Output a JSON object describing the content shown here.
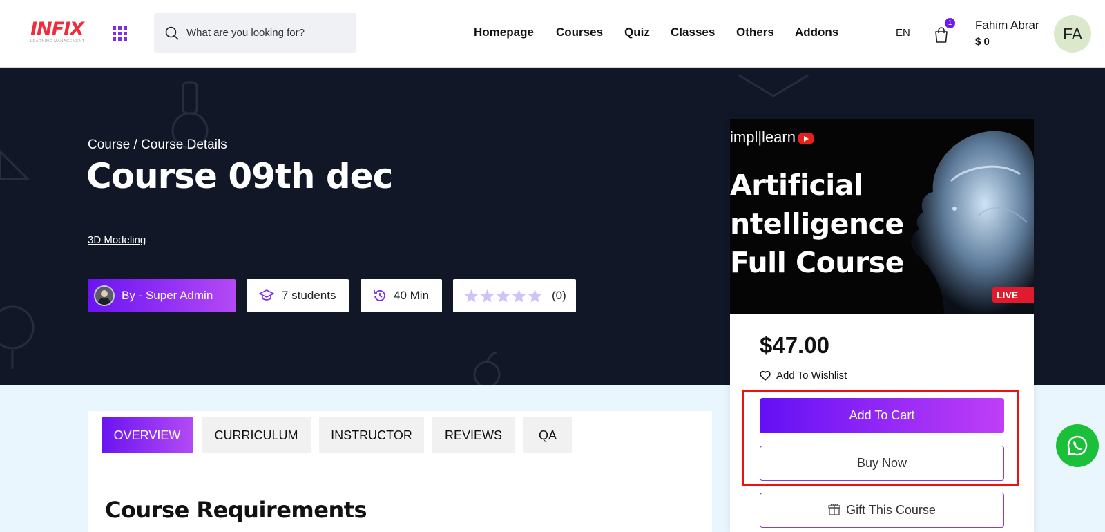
{
  "header": {
    "logo_text": "INFIX",
    "logo_sub": "LEARNING MANAGEMENT",
    "search_placeholder": "What are you looking for?",
    "nav": [
      "Homepage",
      "Courses",
      "Quiz",
      "Classes",
      "Others",
      "Addons"
    ],
    "language": "EN",
    "cart_count": "1",
    "user_name": "Fahim Abrar",
    "user_balance": "$ 0",
    "avatar_initials": "FA"
  },
  "hero": {
    "breadcrumb": "Course / Course Details",
    "title": "Course 09th dec",
    "category": "3D Modeling",
    "instructor": "By - Super Admin",
    "students": "7 students",
    "duration": "40 Min",
    "rating_count": "(0)",
    "rating": 0,
    "rating_max": 5
  },
  "card": {
    "thumb_brand": "impl|learn",
    "thumb_lines": [
      "Artificial",
      "ntelligence",
      "Full Course"
    ],
    "thumb_live": "LIVE",
    "price": "$47.00",
    "wishlist": "Add To Wishlist",
    "add_to_cart": "Add To Cart",
    "buy_now": "Buy Now",
    "gift": "Gift This Course"
  },
  "tabs": [
    "OVERVIEW",
    "CURRICULUM",
    "INSTRUCTOR",
    "REVIEWS",
    "QA"
  ],
  "active_tab": "OVERVIEW",
  "section_title": "Course Requirements",
  "colors": {
    "accent": "#6a14f2",
    "accent_end": "#b44af5",
    "hero_bg": "#111726",
    "highlight": "#ee1111",
    "whatsapp": "#1bbf3a"
  }
}
